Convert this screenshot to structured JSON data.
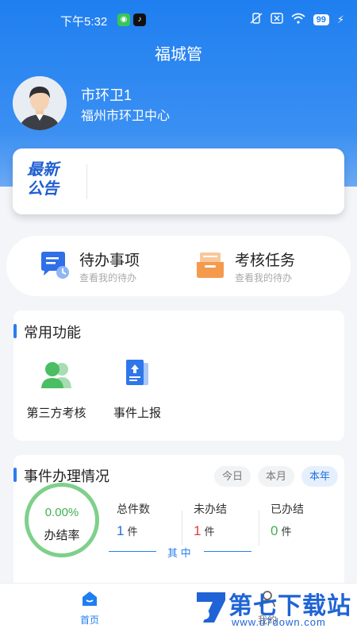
{
  "status_bar": {
    "time": "下午5:32",
    "battery": "99"
  },
  "app": {
    "title": "福城管"
  },
  "user": {
    "name": "市环卫1",
    "organization": "福州市环卫中心"
  },
  "notice": {
    "badge_line1": "最新",
    "badge_line2": "公告"
  },
  "quick_actions": [
    {
      "title": "待办事项",
      "subtitle": "查看我的待办"
    },
    {
      "title": "考核任务",
      "subtitle": "查看我的待办"
    }
  ],
  "common_functions": {
    "title": "常用功能",
    "items": [
      {
        "label": "第三方考核",
        "icon": "people-icon"
      },
      {
        "label": "事件上报",
        "icon": "report-upload-icon"
      }
    ]
  },
  "event_stats": {
    "title": "事件办理情况",
    "filters": [
      "今日",
      "本月",
      "本年"
    ],
    "active_filter": "本年",
    "completion_rate": "0.00%",
    "completion_label": "办结率",
    "unit": "件",
    "stats": [
      {
        "label": "总件数",
        "value": "1",
        "color": "#1f6fe0"
      },
      {
        "label": "未办结",
        "value": "1",
        "color": "#e03a3a"
      },
      {
        "label": "已办结",
        "value": "0",
        "color": "#3fb24f"
      }
    ],
    "among_label": "其 中"
  },
  "tab_bar": {
    "items": [
      {
        "label": "首页",
        "active": true
      },
      {
        "label": "我的",
        "active": false
      }
    ]
  },
  "watermark": {
    "text": "第七下载站",
    "url": "www.d7down.com"
  },
  "colors": {
    "primary": "#1f7ff0",
    "accent_green": "#3fb24f",
    "accent_red": "#e03a3a"
  }
}
